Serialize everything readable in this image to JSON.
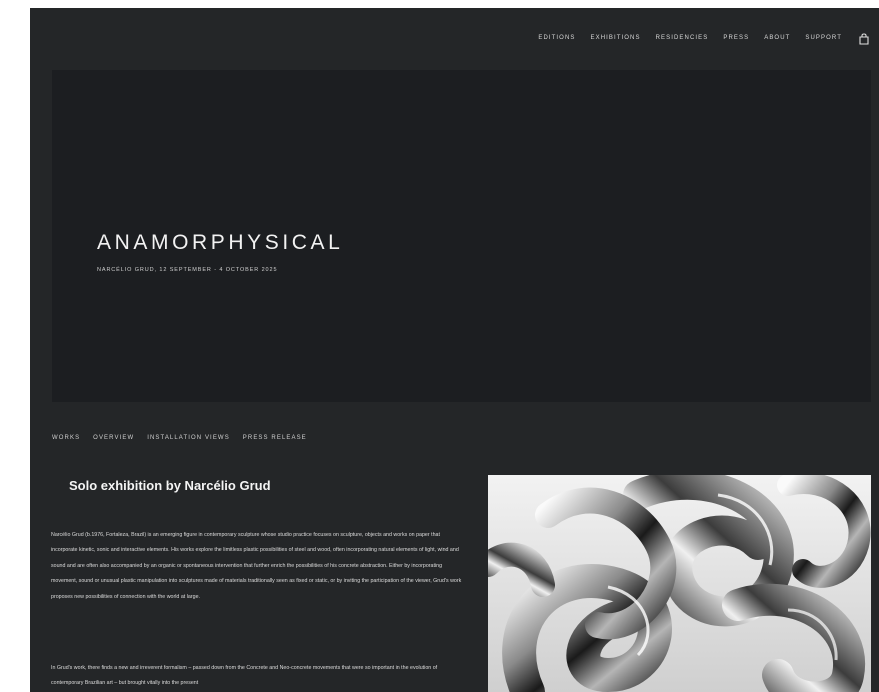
{
  "nav": {
    "items": [
      "EDITIONS",
      "EXHIBITIONS",
      "RESIDENCIES",
      "PRESS",
      "ABOUT",
      "SUPPORT"
    ],
    "cart_icon": "shopping-bag-icon"
  },
  "hero": {
    "title": "ANAMORPHYSICAL",
    "subtitle": "NARCÉLIO GRUD, 12 SEPTEMBER - 4 OCTOBER 2025"
  },
  "subnav": {
    "items": [
      "WORKS",
      "OVERVIEW",
      "INSTALLATION VIEWS",
      "PRESS RELEASE"
    ]
  },
  "content": {
    "heading": "Solo exhibition by Narcélio Grud",
    "paragraph1": "Narcélio Grud (b.1976, Fortaleza, Brazil) is an emerging figure in contemporary sculpture whose studio practice focuses on sculpture, objects and works on paper that incorporate kinetic, sonic and interactive elements. His works explore the limitless plastic possibilities of steel and wood, often incorporating natural elements of light, wind and sound and are often also accompanied by an organic or spontaneous intervention that further enrich the possibilities of his concrete abstraction. Either by incorporating movement, sound or unusual plastic manipulation into sculptures made of materials traditionally seen as fixed or static, or by inviting the participation of the viewer, Grud's work proposes new possibilities of connection with the world at large.",
    "paragraph2": "In Grud's work, there finds a new and irreverent formalism – passed down from the Concrete and Neo-concrete movements that were so important in the evolution of contemporary Brazilian art – but brought vitally into the present"
  },
  "colors": {
    "page_background": "#242628",
    "hero_background": "#1c1e21",
    "text": "#e8e8e8"
  }
}
